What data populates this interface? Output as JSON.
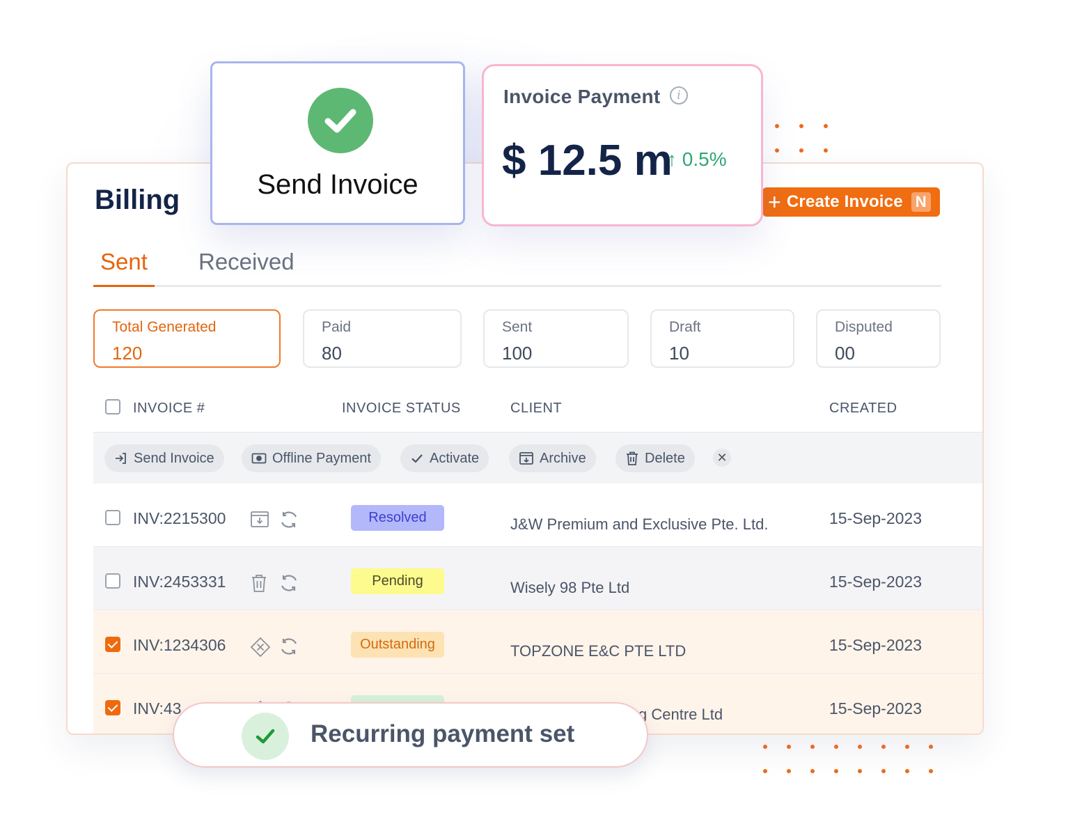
{
  "billing": {
    "title": "Billing",
    "create_button": {
      "label": "Create Invoice",
      "shortcut": "N"
    },
    "tabs": [
      {
        "label": "Sent",
        "active": true
      },
      {
        "label": "Received",
        "active": false
      }
    ],
    "stats": [
      {
        "label": "Total Generated",
        "value": "120",
        "active": true
      },
      {
        "label": "Paid",
        "value": "80"
      },
      {
        "label": "Sent",
        "value": "100"
      },
      {
        "label": "Draft",
        "value": "10"
      },
      {
        "label": "Disputed",
        "value": "00"
      }
    ],
    "table": {
      "headers": {
        "invoice": "INVOICE #",
        "status": "INVOICE STATUS",
        "client": "CLIENT",
        "created": "CREATED"
      },
      "actions": [
        {
          "label": "Send Invoice",
          "icon": "send-icon"
        },
        {
          "label": "Offline Payment",
          "icon": "cash-icon"
        },
        {
          "label": "Activate",
          "icon": "check-icon"
        },
        {
          "label": "Archive",
          "icon": "archive-icon"
        },
        {
          "label": "Delete",
          "icon": "trash-icon"
        }
      ],
      "close_action": "✕",
      "rows": [
        {
          "invoice": "INV:2215300",
          "status": "Resolved",
          "client": "J&W Premium and Exclusive Pte. Ltd.",
          "created": "15-Sep-2023",
          "checked": false,
          "icon": "archive-icon"
        },
        {
          "invoice": "INV:2453331",
          "status": "Pending",
          "client": "Wisely 98 Pte Ltd",
          "created": "15-Sep-2023",
          "checked": false,
          "icon": "trash-icon"
        },
        {
          "invoice": "INV:1234306",
          "status": "Outstanding",
          "client": "TOPZONE E&C PTE LTD",
          "created": "15-Sep-2023",
          "checked": true,
          "icon": "activate-icon"
        },
        {
          "invoice": "INV:43",
          "status": "",
          "client": "g Centre Ltd",
          "created": "15-Sep-2023",
          "checked": true,
          "icon": "activate-icon"
        }
      ]
    }
  },
  "send_invoice_card": {
    "title": "Send Invoice"
  },
  "payment_card": {
    "title": "Invoice Payment",
    "amount": "$ 12.5 m",
    "change": "0.5%",
    "trend": "up"
  },
  "toast": {
    "message": "Recurring payment set"
  },
  "colors": {
    "accent": "#f06d12",
    "navy": "#142448",
    "resolved_bg": "#b3b8fb",
    "resolved_text": "#3e3fcf",
    "pending_bg": "#fdfb8d",
    "pending_text": "#4a4a2a",
    "outstanding_bg": "#fde3b3",
    "outstanding_text": "#d26a12",
    "success": "#5db873"
  }
}
